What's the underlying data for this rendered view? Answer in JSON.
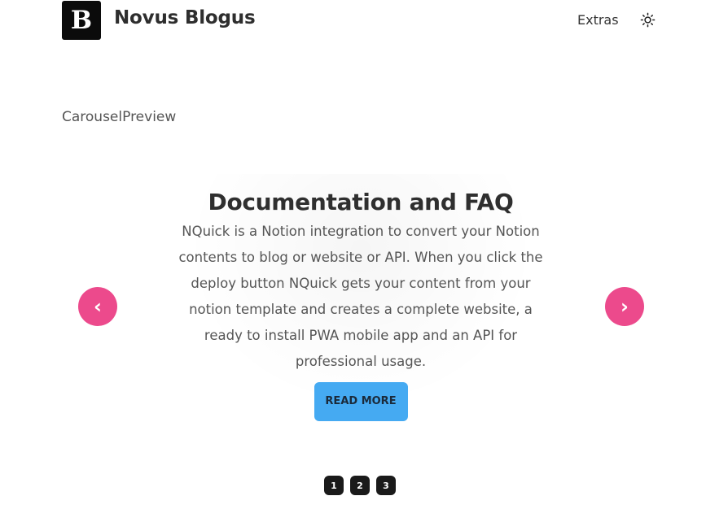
{
  "header": {
    "logo_letter": "B",
    "site_title": "Novus Blogus",
    "nav": {
      "extras_label": "Extras"
    },
    "theme_toggle_icon": "sun-icon"
  },
  "section": {
    "label": "CarouselPreview"
  },
  "carousel": {
    "slide": {
      "title": "Documentation and FAQ",
      "text": "NQuick is a Notion integration to convert your Notion contents to blog or website or API. When you click the deploy button NQuick gets your content from your notion template and creates a complete website, a ready to install PWA mobile app and an API for professional usage.",
      "button_label": "READ MORE"
    },
    "prev_label": "‹",
    "next_label": "›",
    "pages": [
      "1",
      "2",
      "3"
    ]
  },
  "colors": {
    "accent_pink": "#ec4a8c",
    "button_blue": "#45aaf2",
    "logo_bg": "#0b0b0b"
  }
}
